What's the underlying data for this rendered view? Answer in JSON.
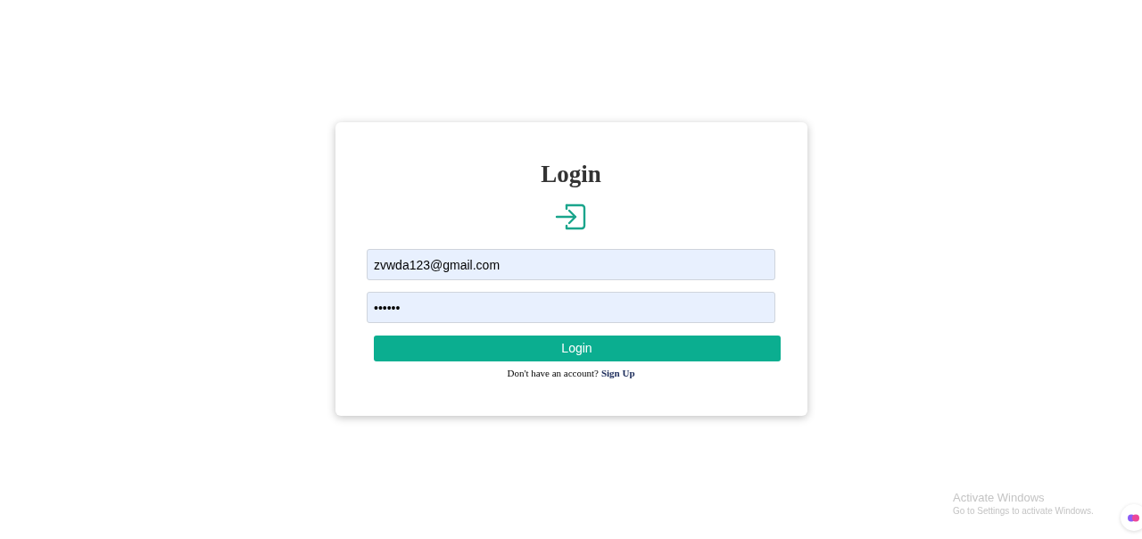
{
  "login_card": {
    "title": "Login",
    "email": {
      "value": "zvwda123@gmail.com"
    },
    "password": {
      "value": "••••••"
    },
    "submit": "Login",
    "signup_prompt": "Don't have an account?",
    "signup_link": "Sign Up"
  },
  "activation_notice": {
    "title": "Activate Windows",
    "subtitle": "Go to Settings to activate Windows."
  }
}
